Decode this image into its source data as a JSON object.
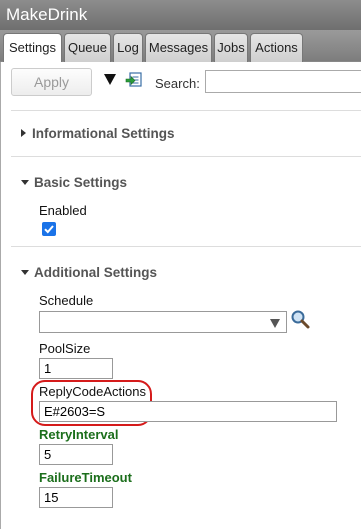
{
  "window": {
    "title": "MakeDrink"
  },
  "tabs": [
    {
      "label": "Settings"
    },
    {
      "label": "Queue"
    },
    {
      "label": "Log"
    },
    {
      "label": "Messages"
    },
    {
      "label": "Jobs"
    },
    {
      "label": "Actions"
    }
  ],
  "toolbar": {
    "apply_label": "Apply",
    "search_label": "Search:",
    "search_value": "",
    "menu_icon": "dropdown-caret",
    "export_icon": "export-icon"
  },
  "sections": {
    "informational": {
      "title": "Informational Settings",
      "expanded": false
    },
    "basic": {
      "title": "Basic Settings",
      "expanded": true
    },
    "additional": {
      "title": "Additional Settings",
      "expanded": true
    }
  },
  "fields": {
    "enabled": {
      "label": "Enabled",
      "checked": true
    },
    "schedule": {
      "label": "Schedule",
      "value": ""
    },
    "pool_size": {
      "label": "PoolSize",
      "value": "1"
    },
    "reply_code_actions": {
      "label": "ReplyCodeActions",
      "value": "E#2603=S"
    },
    "retry_interval": {
      "label": "RetryInterval",
      "value": "5"
    },
    "failure_timeout": {
      "label": "FailureTimeout",
      "value": "15"
    }
  },
  "colors": {
    "accent": "#1a73e8",
    "highlight": "#d51b1b",
    "modified_label": "#1b6e1b",
    "title_bar": "#7d7d7d"
  }
}
